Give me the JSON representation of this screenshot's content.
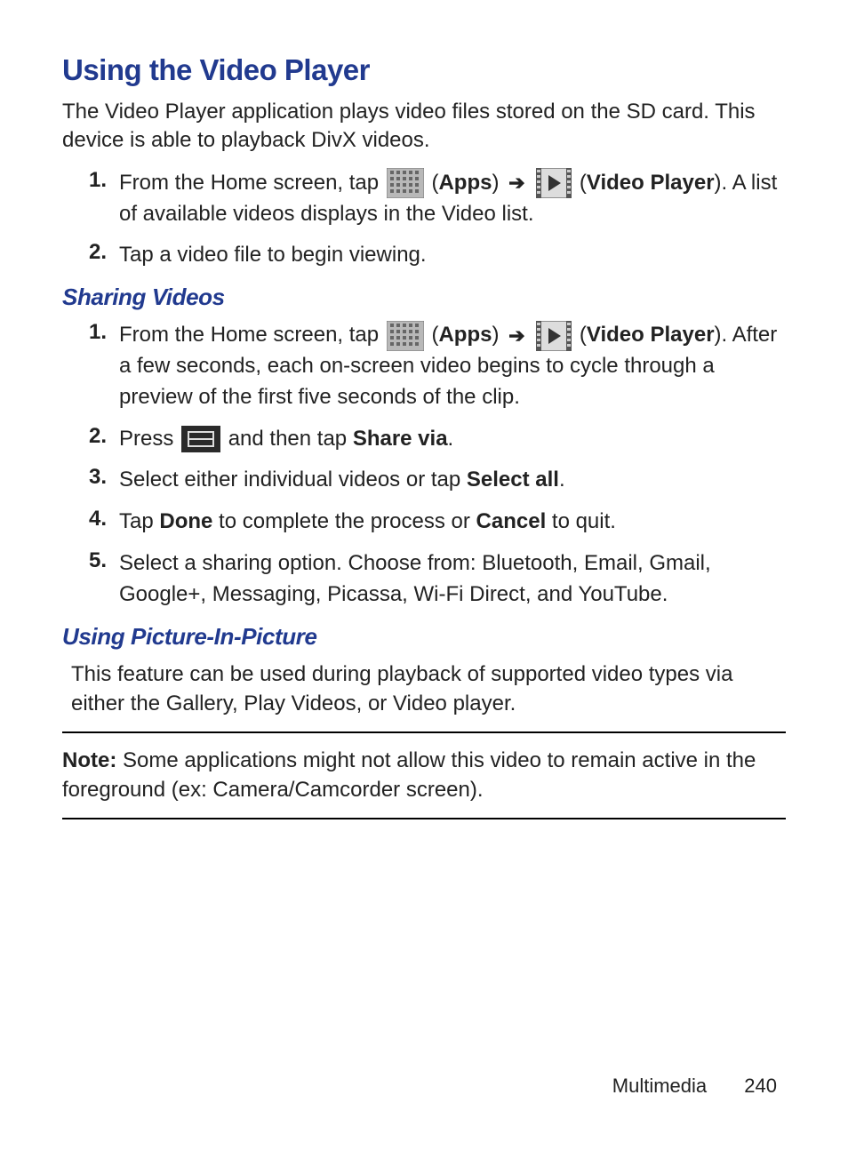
{
  "title": "Using the Video Player",
  "intro": "The Video Player application plays video files stored on the SD card. This device is able to playback DivX videos.",
  "labels": {
    "apps": "Apps",
    "video_player": "Video Player",
    "share_via": "Share via",
    "select_all": "Select all",
    "done": "Done",
    "cancel": "Cancel",
    "note": "Note:"
  },
  "steps_a": [
    {
      "n": "1.",
      "pre": "From the Home screen, tap ",
      "mid": "A list of available videos displays in the Video list."
    },
    {
      "n": "2.",
      "text": "Tap a video file to begin viewing."
    }
  ],
  "heading_b": "Sharing Videos",
  "steps_b": [
    {
      "n": "1.",
      "pre": "From the Home screen, tap ",
      "mid": "After a few seconds, each on-screen video begins to cycle through a preview of the first five seconds of the clip."
    },
    {
      "n": "2.",
      "pre": "Press ",
      "post": " and then tap "
    },
    {
      "n": "3.",
      "pre": "Select either individual videos or tap "
    },
    {
      "n": "4.",
      "pre": "Tap ",
      "mid": " to complete the process or ",
      "post": " to quit."
    },
    {
      "n": "5.",
      "text": "Select a sharing option. Choose from: Bluetooth, Email, Gmail, Google+, Messaging, Picassa, Wi-Fi Direct, and YouTube."
    }
  ],
  "heading_c": "Using Picture-In-Picture",
  "pip_text": "This feature can be used during playback of supported video types via either the Gallery, Play Videos, or Video player.",
  "note_text": "Some applications might not allow this video to remain active in the foreground (ex: Camera/Camcorder screen).",
  "footer": {
    "section": "Multimedia",
    "page": "240"
  }
}
